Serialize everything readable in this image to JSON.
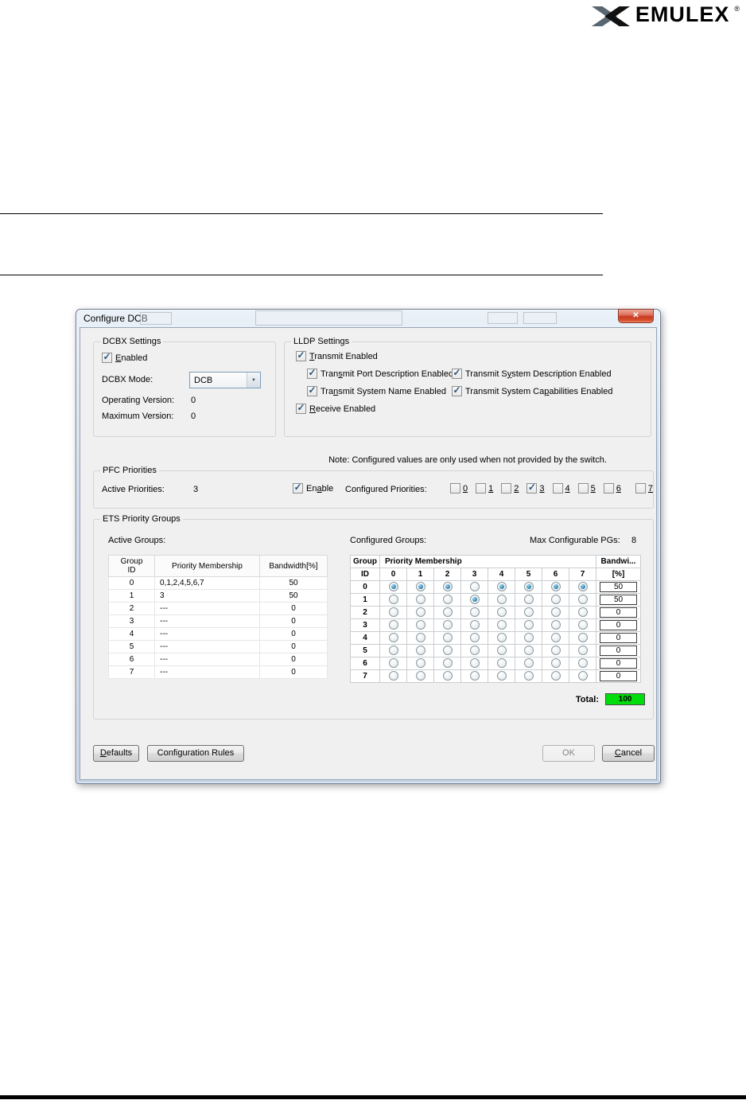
{
  "logo": {
    "text": "EMULEX",
    "reg": "®"
  },
  "icons": {
    "close": "✕",
    "combo_arrow": "▼"
  },
  "dialog": {
    "title": "Configure DCB",
    "dcbx": {
      "label": "DCBX Settings",
      "enabled_label": "Enabled",
      "enabled_checked": true,
      "mode_label": "DCBX Mode:",
      "mode_value": "DCB",
      "operating_version_label": "Operating Version:",
      "operating_version_value": "0",
      "maximum_version_label": "Maximum Version:",
      "maximum_version_value": "0"
    },
    "lldp": {
      "label": "LLDP Settings",
      "transmit_enabled_label": "Transmit Enabled",
      "transmit_enabled_checked": true,
      "port_description_label": "Transmit Port Description Enabled",
      "port_description_checked": true,
      "system_description_label": "Transmit System Description Enabled",
      "system_description_checked": true,
      "system_name_label": "Transmit System Name Enabled",
      "system_name_checked": true,
      "system_capabilities_label": "Transmit System Capabilities Enabled",
      "system_capabilities_checked": true,
      "receive_enabled_label": "Receive Enabled",
      "receive_enabled_checked": true
    },
    "note": "Note: Configured values are only used when not provided by the switch.",
    "pfc": {
      "label": "PFC Priorities",
      "active_priorities_label": "Active Priorities:",
      "active_priorities_value": "3",
      "enable_label": "Enable",
      "enable_checked": true,
      "configured_priorities_label": "Configured Priorities:",
      "priorities": [
        {
          "label": "0",
          "checked": false
        },
        {
          "label": "1",
          "checked": false
        },
        {
          "label": "2",
          "checked": false
        },
        {
          "label": "3",
          "checked": true
        },
        {
          "label": "4",
          "checked": false
        },
        {
          "label": "5",
          "checked": false
        },
        {
          "label": "6",
          "checked": false
        },
        {
          "label": "7",
          "checked": false
        }
      ]
    },
    "ets": {
      "label": "ETS Priority Groups",
      "active_groups_label": "Active Groups:",
      "active_table": {
        "headers": [
          "Group\nID",
          "Priority Membership",
          "Bandwidth[%]"
        ],
        "rows": [
          [
            "0",
            "0,1,2,4,5,6,7",
            "50"
          ],
          [
            "1",
            "3",
            "50"
          ],
          [
            "2",
            "---",
            "0"
          ],
          [
            "3",
            "---",
            "0"
          ],
          [
            "4",
            "---",
            "0"
          ],
          [
            "5",
            "---",
            "0"
          ],
          [
            "6",
            "---",
            "0"
          ],
          [
            "7",
            "---",
            "0"
          ]
        ]
      },
      "configured_groups_label": "Configured Groups:",
      "max_pgs_label": "Max Configurable PGs:",
      "max_pgs_value": "8",
      "config_table": {
        "group_header": "Group",
        "id_header": "ID",
        "membership_header": "Priority Membership",
        "bandwidth_header": "Bandwi...",
        "bandwidth_unit_header": "[%]",
        "priority_columns": [
          "0",
          "1",
          "2",
          "3",
          "4",
          "5",
          "6",
          "7"
        ],
        "rows": [
          {
            "id": "0",
            "selected": [
              true,
              true,
              true,
              false,
              true,
              true,
              true,
              true
            ],
            "bandwidth": "50"
          },
          {
            "id": "1",
            "selected": [
              false,
              false,
              false,
              true,
              false,
              false,
              false,
              false
            ],
            "bandwidth": "50"
          },
          {
            "id": "2",
            "selected": [
              false,
              false,
              false,
              false,
              false,
              false,
              false,
              false
            ],
            "bandwidth": "0"
          },
          {
            "id": "3",
            "selected": [
              false,
              false,
              false,
              false,
              false,
              false,
              false,
              false
            ],
            "bandwidth": "0"
          },
          {
            "id": "4",
            "selected": [
              false,
              false,
              false,
              false,
              false,
              false,
              false,
              false
            ],
            "bandwidth": "0"
          },
          {
            "id": "5",
            "selected": [
              false,
              false,
              false,
              false,
              false,
              false,
              false,
              false
            ],
            "bandwidth": "0"
          },
          {
            "id": "6",
            "selected": [
              false,
              false,
              false,
              false,
              false,
              false,
              false,
              false
            ],
            "bandwidth": "0"
          },
          {
            "id": "7",
            "selected": [
              false,
              false,
              false,
              false,
              false,
              false,
              false,
              false
            ],
            "bandwidth": "0"
          }
        ]
      },
      "total_label": "Total:",
      "total_value": "100",
      "total_bg_color": "#00dd0c"
    },
    "buttons": {
      "defaults": "Defaults",
      "configuration_rules": "Configuration Rules",
      "ok": "OK",
      "cancel": "Cancel"
    }
  }
}
